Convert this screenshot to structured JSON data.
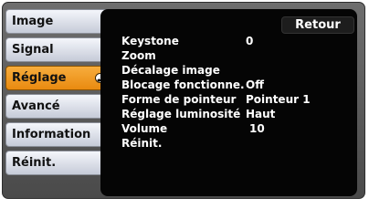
{
  "sidebar": {
    "items": [
      {
        "label": "Image"
      },
      {
        "label": "Signal"
      },
      {
        "label": "Réglage"
      },
      {
        "label": "Avancé"
      },
      {
        "label": "Information"
      },
      {
        "label": "Réinit."
      }
    ],
    "active_item": "Réglage",
    "active_icon": "enter-icon"
  },
  "panel": {
    "back_label": "Retour",
    "rows": [
      {
        "label": "Keystone",
        "value": "0"
      },
      {
        "label": "Zoom",
        "value": ""
      },
      {
        "label": "Décalage image",
        "value": ""
      },
      {
        "label": "Blocage fonctionne.",
        "value": "Off"
      },
      {
        "label": "Forme de pointeur",
        "value": "Pointeur 1"
      },
      {
        "label": "Réglage luminosité",
        "value": "Haut"
      },
      {
        "label": "Volume",
        "value": "10"
      },
      {
        "label": "Réinit.",
        "value": ""
      }
    ]
  },
  "colors": {
    "active_tab": "#f19a22",
    "inactive_tab": "#e3e6ee",
    "panel_background": "#050505",
    "frame_background": "#5a5a5a",
    "text_on_panel": "#ffffff"
  }
}
